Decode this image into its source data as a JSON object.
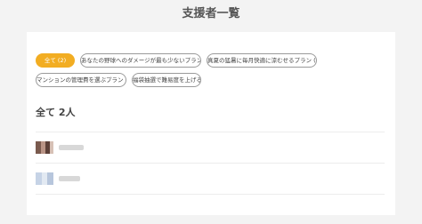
{
  "page": {
    "title": "支援者一覧"
  },
  "filters": [
    {
      "label": "全て (2)",
      "active": true
    },
    {
      "label": "あなたの野球へのダメージが最も少ないプラン (0)",
      "active": false
    },
    {
      "label": "真夏の猛暑に毎月快適に涼むせるプラン (1)",
      "active": false
    },
    {
      "label": "マンションの管理費を選ぶプラン (1)",
      "active": false
    },
    {
      "label": "福袋抽選で難易度を上げる (0)",
      "active": false
    }
  ],
  "supporters": {
    "heading": "全て 2人"
  },
  "colors": {
    "accent": "#f2ad22",
    "background": "#f3f3f3",
    "card": "#ffffff"
  }
}
